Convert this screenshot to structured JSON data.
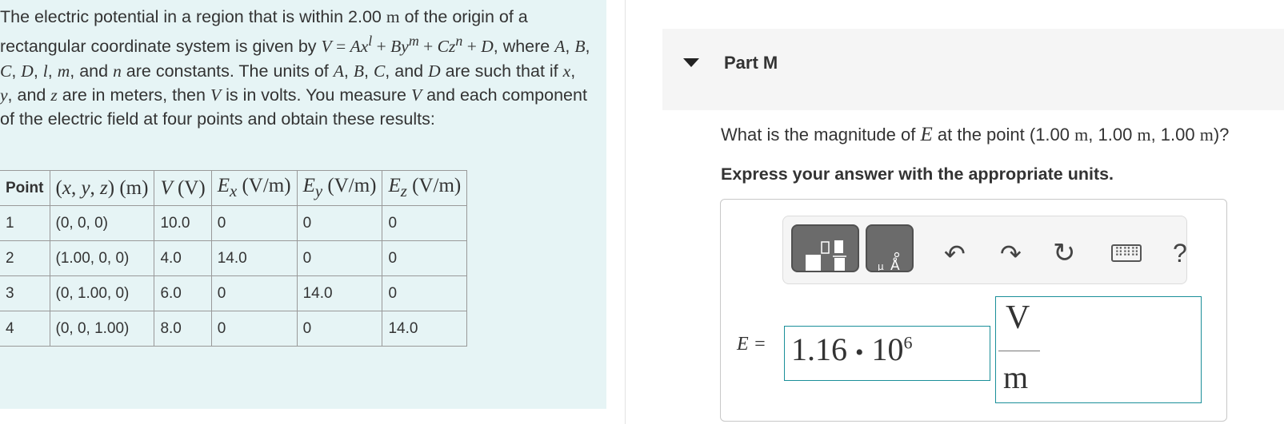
{
  "problem": {
    "intro": "The electric potential in a region that is within 2.00",
    "radius_unit": "m",
    "intro_tail": "of the origin of a rectangular coordinate system is given by",
    "where": ", where",
    "and_word": "and",
    "are_word": "are constants. The units of",
    "such_that": "are such that if",
    "meters_phrase": "are in meters, then",
    "volts_phrase": "is in volts. You measure",
    "tail": "and each component of the electric field at four points and obtain these results:"
  },
  "table": {
    "headers": [
      "Point",
      "(x, y, z) (m)",
      "V (V)",
      "Ex (V/m)",
      "Ey (V/m)",
      "Ez (V/m)"
    ],
    "rows": [
      [
        "1",
        "(0, 0, 0)",
        "10.0",
        "0",
        "0",
        "0"
      ],
      [
        "2",
        "(1.00, 0, 0)",
        "4.0",
        "14.0",
        "0",
        "0"
      ],
      [
        "3",
        "(0, 1.00, 0)",
        "6.0",
        "0",
        "14.0",
        "0"
      ],
      [
        "4",
        "(0, 0, 1.00)",
        "8.0",
        "0",
        "0",
        "14.0"
      ]
    ]
  },
  "part": {
    "title": "Part M"
  },
  "question": {
    "prefix": "What is the magnitude of",
    "point_prefix": "at the point (1.00",
    "coord2": ", 1.00",
    "coord3": ", 1.00",
    "unit": "m",
    "suffix": ")?"
  },
  "instruction": "Express your answer with the appropriate units.",
  "toolbar": {
    "icons": [
      "templates-icon",
      "units-icon",
      "undo-icon",
      "redo-icon",
      "reset-icon",
      "keyboard-icon",
      "help-icon"
    ]
  },
  "answer": {
    "label": "E =",
    "value_mantissa": "1.16",
    "value_dot": "•",
    "value_base": "10",
    "value_exponent": "6",
    "unit_numerator": "V",
    "unit_denominator": "m"
  },
  "colors": {
    "panel_bg": "#e6f4f5",
    "input_border": "#1a8f99",
    "button_bg": "#6b6b6b"
  }
}
